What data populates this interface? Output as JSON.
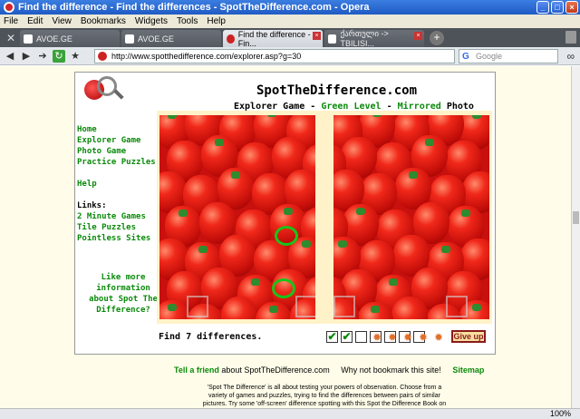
{
  "window": {
    "title": "Find the difference - Find the differences - SpotTheDifference.com - Opera",
    "controls": [
      "_",
      "□",
      "×"
    ]
  },
  "menu": [
    "File",
    "Edit",
    "View",
    "Bookmarks",
    "Widgets",
    "Tools",
    "Help"
  ],
  "tabs": [
    {
      "label": "AVOE.GE"
    },
    {
      "label": "AVOE.GE"
    },
    {
      "label": "Find the difference - Fin..."
    },
    {
      "label": "ქართული -> TBILISI..."
    }
  ],
  "address": {
    "url": "http://www.spotthedifference.com/explorer.asp?g=30",
    "search_placeholder": "Google",
    "search_letter": "G"
  },
  "site": {
    "title": "SpotTheDifference.com",
    "subtitle_start": "Explorer Game - ",
    "subtitle_level": "Green Level",
    "subtitle_mid": " - ",
    "subtitle_mode": "Mirrored",
    "subtitle_end": " Photo",
    "nav": [
      "Home",
      "Explorer Game",
      "Photo Game",
      "Practice Puzzles",
      "Help"
    ],
    "links_label": "Links:",
    "links": [
      "2 Minute Games",
      "Tile Puzzles",
      "Pointless Sites"
    ],
    "promo": "Like more information about Spot The Difference?",
    "find_label": "Find 7 differences.",
    "check_mark": "✔",
    "found": 2,
    "total": 7,
    "hints": 5,
    "hint_glyph": "✹",
    "give_up": "Give up"
  },
  "footer": {
    "tell": "Tell a friend",
    "about_site": " about SpotTheDifference.com",
    "bookmark": "Why not bookmark this site!",
    "sitemap": "Sitemap",
    "about_text": "'Spot The Difference' is all about testing your powers of observation. Choose from a variety of games and puzzles, trying to find the differences between pairs of similar pictures. Try some 'off-screen' difference spotting with this Spot the Difference Book on these..."
  },
  "status": {
    "zoom": "100%"
  }
}
